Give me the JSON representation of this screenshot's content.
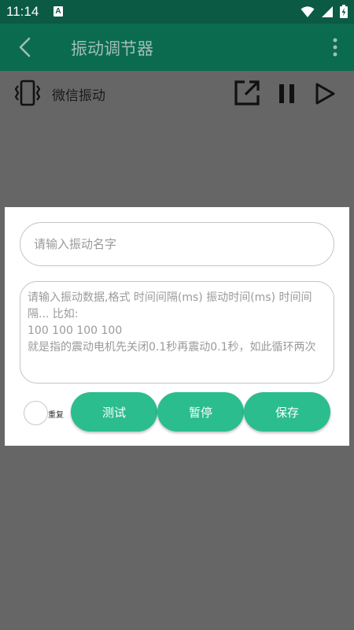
{
  "status_bar": {
    "time": "11:14",
    "notification_icon": "A"
  },
  "app_bar": {
    "title": "振动调节器",
    "back_icon": "chevron-left-icon",
    "more_icon": "more-vert-icon"
  },
  "vibration_row": {
    "label": "微信振动",
    "icon": "vibrate-icon",
    "actions": [
      "share-external-icon",
      "pause-icon",
      "play-icon"
    ]
  },
  "dialog": {
    "name_placeholder": "请输入振动名字",
    "data_placeholder": "请输入振动数据,格式 时间间隔(ms) 振动时间(ms) 时间间隔... 比如:\n100 100 100 100\n就是指的震动电机先关闭0.1秒再震动0.1秒，如此循环两次",
    "repeat_label": "重复",
    "buttons": {
      "test": "测试",
      "pause": "暂停",
      "save": "保存"
    }
  },
  "colors": {
    "status_bar": "#0b5a43",
    "app_bar": "#0b6b4f",
    "overlay": "#666666",
    "accent": "#2bbd8d"
  }
}
